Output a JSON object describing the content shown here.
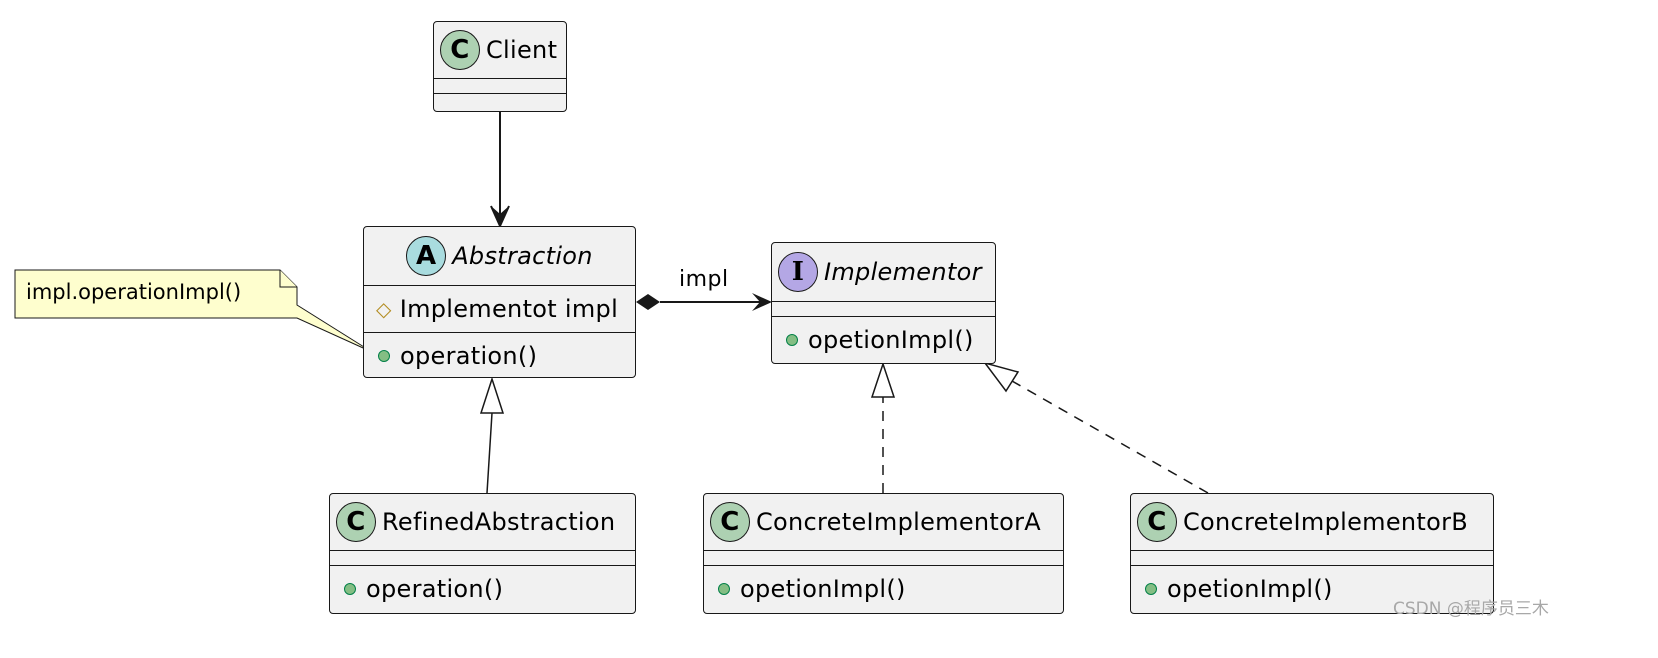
{
  "diagram": {
    "type": "uml-class-diagram",
    "classes": {
      "client": {
        "stereotype": "C",
        "name": "Client",
        "attributes": [],
        "methods": []
      },
      "abstraction": {
        "stereotype": "A",
        "name": "Abstraction",
        "italic": true,
        "attributes": [
          {
            "visibility": "#",
            "text": "Implementot impl"
          }
        ],
        "methods": [
          {
            "visibility": "+",
            "text": "operation()"
          }
        ]
      },
      "implementor": {
        "stereotype": "I",
        "name": "Implementor",
        "italic": true,
        "attributes": [],
        "methods": [
          {
            "visibility": "+",
            "text": "opetionImpl()"
          }
        ]
      },
      "refined": {
        "stereotype": "C",
        "name": "RefinedAbstraction",
        "attributes": [],
        "methods": [
          {
            "visibility": "+",
            "text": "operation()"
          }
        ]
      },
      "concreteA": {
        "stereotype": "C",
        "name": "ConcreteImplementorA",
        "attributes": [],
        "methods": [
          {
            "visibility": "+",
            "text": "opetionImpl()"
          }
        ]
      },
      "concreteB": {
        "stereotype": "C",
        "name": "ConcreteImplementorB",
        "attributes": [],
        "methods": [
          {
            "visibility": "+",
            "text": "opetionImpl()"
          }
        ]
      }
    },
    "relations": [
      {
        "from": "Client",
        "to": "Abstraction",
        "kind": "association"
      },
      {
        "from": "Abstraction",
        "to": "Implementor",
        "kind": "composition",
        "label": "impl"
      },
      {
        "from": "RefinedAbstraction",
        "to": "Abstraction",
        "kind": "generalization"
      },
      {
        "from": "ConcreteImplementorA",
        "to": "Implementor",
        "kind": "realization"
      },
      {
        "from": "ConcreteImplementorB",
        "to": "Implementor",
        "kind": "realization"
      }
    ],
    "note": {
      "text": "impl.operationImpl()",
      "attached_to": "Abstraction.operation()"
    },
    "edge_label": "impl"
  },
  "watermark": "CSDN @程序员三木",
  "colors": {
    "class_fill": "#f1f1f1",
    "border": "#181818",
    "class_badge": "#add1b2",
    "abstract_badge": "#a9dcdf",
    "interface_badge": "#b4a7e5",
    "note_fill": "#fefece",
    "public_dot": "#84be84",
    "protected_diamond": "#b38d22"
  }
}
